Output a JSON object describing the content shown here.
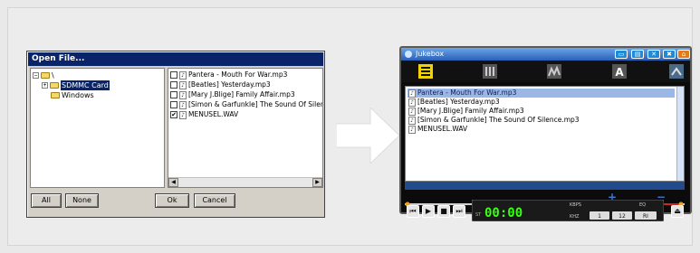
{
  "dialog": {
    "title": "Open File...",
    "tree": [
      {
        "expander": "−",
        "label": "\\"
      },
      {
        "expander": "+",
        "label": "SDMMC Card"
      },
      {
        "expander": "",
        "label": "Windows"
      }
    ],
    "files": [
      {
        "checked": false,
        "name": "Pantera - Mouth For War.mp3"
      },
      {
        "checked": false,
        "name": "[Beatles] Yesterday.mp3"
      },
      {
        "checked": false,
        "name": "[Mary J.Blige] Family Affair.mp3"
      },
      {
        "checked": false,
        "name": "[Simon & Garfunkle] The Sound Of Silence.r"
      },
      {
        "checked": true,
        "name": "MENUSEL.WAV"
      }
    ],
    "buttons": {
      "all": "All",
      "none": "None",
      "ok": "Ok",
      "cancel": "Cancel"
    }
  },
  "jukebox": {
    "title": "Jukebox",
    "playlist": [
      {
        "name": "Pantera - Mouth For War.mp3",
        "selected": true
      },
      {
        "name": "[Beatles] Yesterday.mp3",
        "selected": false
      },
      {
        "name": "[Mary J.Blige] Family Affair.mp3",
        "selected": false
      },
      {
        "name": "[Simon & Garfunkle] The Sound Of Silence.mp3",
        "selected": false
      },
      {
        "name": "MENUSEL.WAV",
        "selected": false
      }
    ],
    "time": "00:00",
    "kbps_label": "KBPS",
    "khz_label": "KHZ",
    "eq_label": "EQ",
    "track_prefix": "ST",
    "mode_buttons": [
      "1",
      "12",
      "RI"
    ]
  },
  "colors": {
    "dialog_title": "#0a246a",
    "jukebox_accent": "#2a5fb8",
    "lcd_green": "#39ff14",
    "arrow": "#ffffff"
  }
}
